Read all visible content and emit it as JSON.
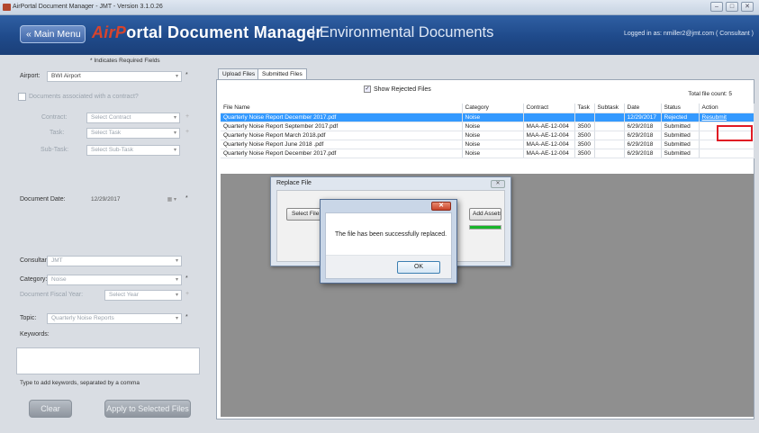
{
  "window": {
    "title": "AirPortal Document Manager - JMT - Version 3.1.0.26",
    "controls": [
      "–",
      "□",
      "✕"
    ]
  },
  "header": {
    "main_menu": "« Main Menu",
    "title_prefix": "AirP",
    "title_rest": "ortal Document Manager",
    "subtitle": "| Environmental Documents",
    "logged_in": "Logged in as: nmiller2@jmt.com ( Consultant )"
  },
  "form": {
    "required_note": "* Indicates Required Fields",
    "airport_label": "Airport:",
    "airport_value": "BWI Airport",
    "contract_check_label": "Documents associated with a contract?",
    "contract_label": "Contract:",
    "contract_value": "Select Contract",
    "task_label": "Task:",
    "task_value": "Select Task",
    "subtask_label": "Sub-Task:",
    "subtask_value": "Select Sub-Task",
    "doc_date_label": "Document Date:",
    "doc_date_value": "12/29/2017",
    "consultant_label": "Consultant:",
    "consultant_value": "JMT",
    "category_label": "Category:",
    "category_value": "Noise",
    "fiscal_year_label": "Document Fiscal Year:",
    "fiscal_year_value": "Select Year",
    "topic_label": "Topic:",
    "topic_value": "Quarterly Noise Reports",
    "keywords_label": "Keywords:",
    "keywords_hint": "Type to add keywords, separated by a comma",
    "clear_button": "Clear",
    "apply_button": "Apply to Selected Files",
    "required_mark": "*",
    "optional_mark": "+"
  },
  "tabs": [
    {
      "label": "Upload Files"
    },
    {
      "label": "Submitted Files"
    }
  ],
  "files": {
    "show_rejected_label": "Show Rejected Files",
    "show_rejected_checked": true,
    "total_label": "Total file count: 5",
    "columns": [
      "File Name",
      "Category",
      "Contract",
      "Task",
      "Subtask",
      "Date",
      "Status",
      "Action"
    ],
    "rows": [
      {
        "name": "Quarterly Noise Report December 2017.pdf",
        "category": "Noise",
        "contract": "",
        "task": "",
        "subtask": "",
        "date": "12/29/2017",
        "status": "Rejected",
        "action": "Resubmit",
        "selected": true
      },
      {
        "name": "Quarterly Noise Report September 2017.pdf",
        "category": "Noise",
        "contract": "MAA-AE-12-004",
        "task": "3500",
        "subtask": "",
        "date": "6/29/2018",
        "status": "Submitted",
        "action": "",
        "selected": false
      },
      {
        "name": "Quarterly Noise Report March 2018.pdf",
        "category": "Noise",
        "contract": "MAA-AE-12-004",
        "task": "3500",
        "subtask": "",
        "date": "6/29/2018",
        "status": "Submitted",
        "action": "",
        "selected": false
      },
      {
        "name": "Quarterly Noise Report June 2018 .pdf",
        "category": "Noise",
        "contract": "MAA-AE-12-004",
        "task": "3500",
        "subtask": "",
        "date": "6/29/2018",
        "status": "Submitted",
        "action": "",
        "selected": false
      },
      {
        "name": "Quarterly Noise Report December 2017.pdf",
        "category": "Noise",
        "contract": "MAA-AE-12-004",
        "task": "3500",
        "subtask": "",
        "date": "6/29/2018",
        "status": "Submitted",
        "action": "",
        "selected": false
      }
    ]
  },
  "replace_dialog": {
    "title": "Replace File",
    "close": "✕",
    "select_file_button": "Select File",
    "add_assets_button": "Add Assets",
    "progress": 1.0
  },
  "message_box": {
    "close": "✕",
    "message": "The file has been successfully replaced.",
    "ok_button": "OK"
  },
  "colors": {
    "header": "#1f4a8a",
    "brand_red": "#d8442c",
    "selection": "#3399ff",
    "highlight": "#e01b24",
    "progress": "#19b52a"
  }
}
